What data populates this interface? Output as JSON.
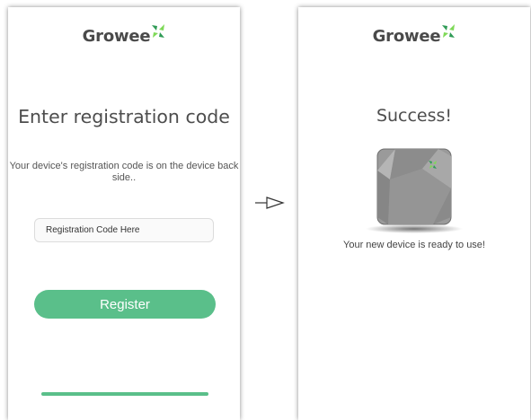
{
  "registration_screen": {
    "logo_text": "Growee",
    "title": "Enter registration code",
    "subtitle": "Your device's registration code is on the device back side..",
    "code_input": {
      "placeholder": "Registration Code Here",
      "value": ""
    },
    "register_button_label": "Register"
  },
  "success_screen": {
    "logo_text": "Growee",
    "title": "Success!",
    "message": "Your new device is ready to use!"
  },
  "colors": {
    "brand_green": "#5abf8a",
    "leaf_dark": "#2e9b55",
    "leaf_light": "#7ed957",
    "device_gray": "#9a9a9a"
  },
  "icons": [
    "growee-leaf-logo-icon",
    "arrow-right-icon",
    "device-illustration"
  ]
}
